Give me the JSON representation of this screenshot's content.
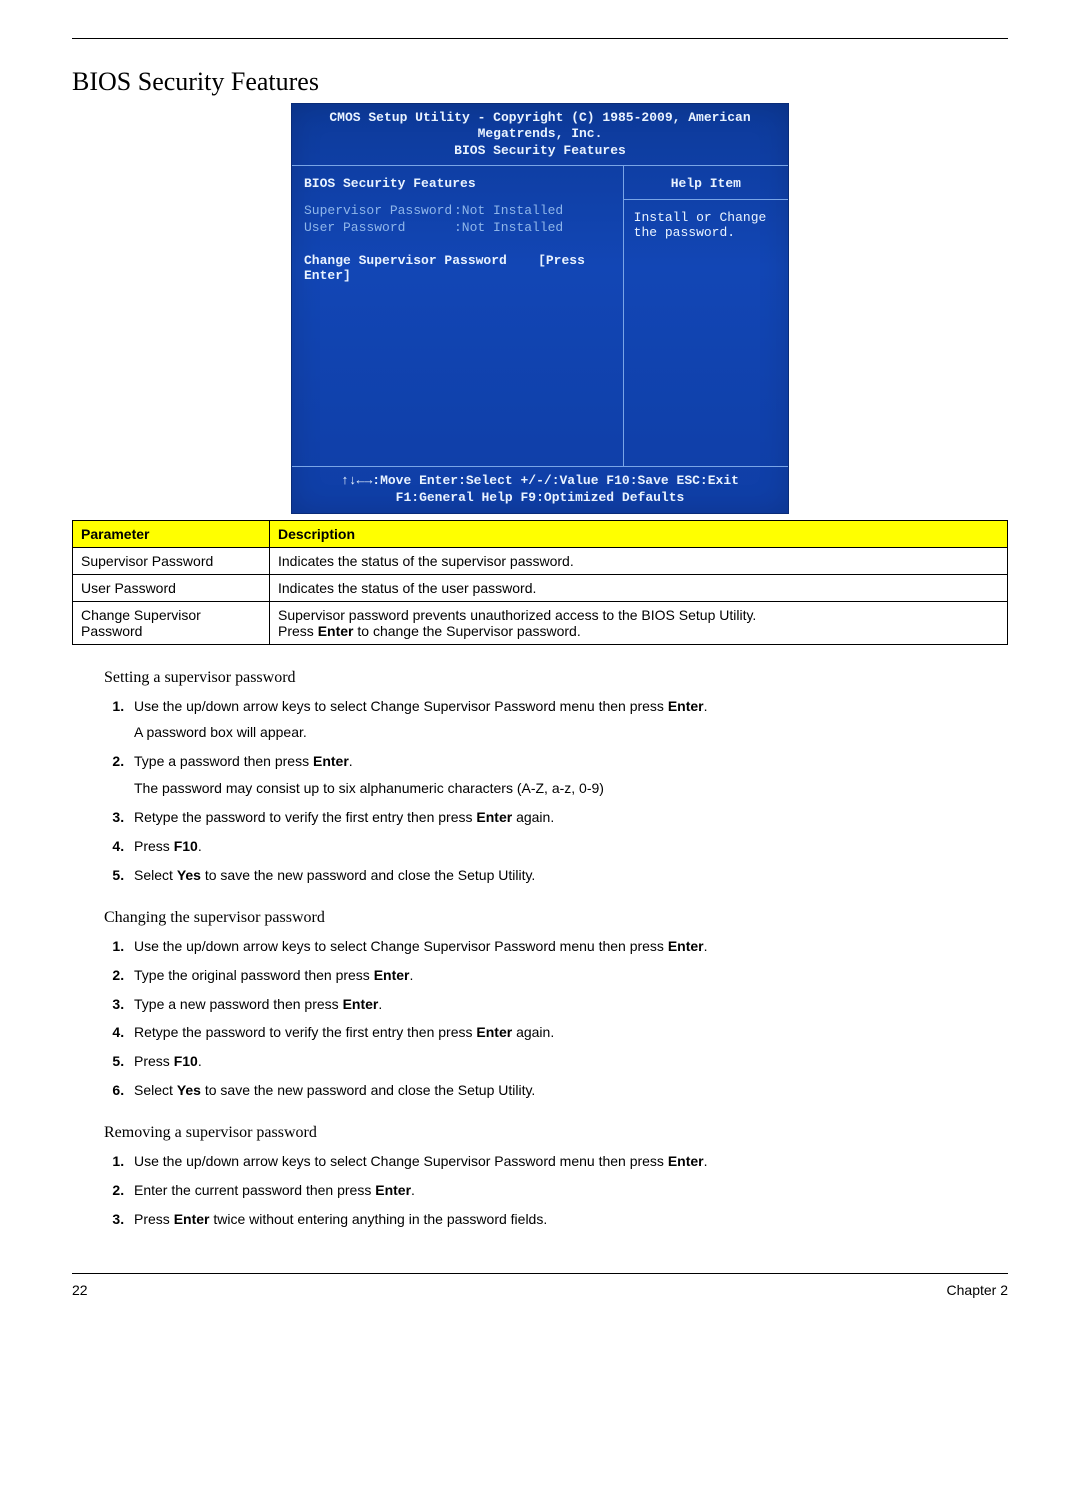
{
  "page": {
    "title": "BIOS Security Features",
    "number": "22",
    "chapter": "Chapter 2"
  },
  "bios": {
    "title_line1": "CMOS Setup Utility - Copyright (C) 1985-2009, American Megatrends, Inc.",
    "title_line2": "BIOS Security Features",
    "left_header": "BIOS Security Features",
    "supervisor_pw_label": "Supervisor Password",
    "supervisor_pw_value": ":Not Installed",
    "user_pw_label": "User Password",
    "user_pw_value": ":Not Installed",
    "change_pw_label": "Change Supervisor Password",
    "change_pw_action": "[Press Enter]",
    "help_header": "Help Item",
    "help_text": "Install or Change the password.",
    "footer_line1": "↑↓←→:Move   Enter:Select   +/-/:Value   F10:Save   ESC:Exit",
    "footer_line2": "F1:General Help          F9:Optimized Defaults"
  },
  "table": {
    "headers": {
      "param": "Parameter",
      "desc": "Description"
    },
    "rows": [
      {
        "param": "Supervisor Password",
        "desc": "Indicates the status of the supervisor password."
      },
      {
        "param": "User Password",
        "desc": "Indicates the status of the user password."
      },
      {
        "param": "Change Supervisor Password",
        "desc_line1": "Supervisor password prevents unauthorized access to the BIOS Setup Utility.",
        "desc_line2_a": "Press ",
        "desc_line2_b": "Enter",
        "desc_line2_c": " to change the Supervisor password."
      }
    ]
  },
  "sections": {
    "setting": {
      "title": "Setting a supervisor password",
      "steps": [
        {
          "a": "Use the up/down arrow keys to select Change Supervisor Password menu then press ",
          "b": "Enter",
          "c": ".",
          "sub": "A password box will appear."
        },
        {
          "a": "Type a password then press ",
          "b": "Enter",
          "c": ".",
          "sub": "The password may consist up to six alphanumeric characters (A-Z, a-z, 0-9)"
        },
        {
          "a": "Retype the password to verify the first entry then press ",
          "b": "Enter",
          "c": " again."
        },
        {
          "a": "Press ",
          "b": "F10",
          "c": "."
        },
        {
          "a": "Select ",
          "b": "Yes",
          "c": " to save the new password and close the Setup Utility."
        }
      ]
    },
    "changing": {
      "title": "Changing the supervisor password",
      "steps": [
        {
          "a": "Use the up/down arrow keys to select Change Supervisor Password menu then press ",
          "b": "Enter",
          "c": "."
        },
        {
          "a": "Type the original password then press ",
          "b": "Enter",
          "c": "."
        },
        {
          "a": "Type a new password then press ",
          "b": "Enter",
          "c": "."
        },
        {
          "a": "Retype the password to verify the first entry then press ",
          "b": "Enter",
          "c": " again."
        },
        {
          "a": "Press ",
          "b": "F10",
          "c": "."
        },
        {
          "a": "Select ",
          "b": "Yes",
          "c": " to save the new password and close the Setup Utility."
        }
      ]
    },
    "removing": {
      "title": "Removing a supervisor password",
      "steps": [
        {
          "a": "Use the up/down arrow keys to select Change Supervisor Password menu then press ",
          "b": "Enter",
          "c": "."
        },
        {
          "a": "Enter the current password then press ",
          "b": "Enter",
          "c": "."
        },
        {
          "a": "Press ",
          "b": "Enter",
          "c": " twice without entering anything in the password fields."
        }
      ]
    }
  }
}
